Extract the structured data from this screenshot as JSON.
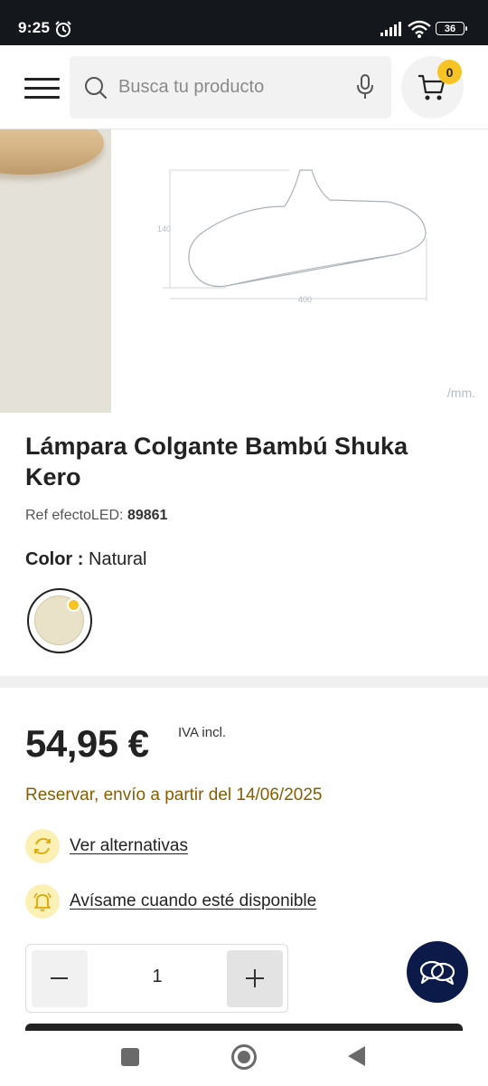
{
  "status_bar": {
    "time": "9:25",
    "battery": "36"
  },
  "header": {
    "search_placeholder": "Busca tu producto",
    "cart_count": "0"
  },
  "gallery": {
    "dimension_height": "140",
    "dimension_width": "400",
    "unit_label": "/mm."
  },
  "product": {
    "title": "Lámpara Colgante Bambú Shuka Kero",
    "ref_label": "Ref efectoLED:",
    "ref_value": "89861",
    "color_label": "Color :",
    "color_value": "Natural",
    "swatch_color": "#e9e2c8",
    "price": "54,95 €",
    "tax_note": "IVA incl.",
    "availability": "Reservar, envío a partir del 14/06/2025",
    "alternatives_link": "Ver alternativas",
    "notify_link": "Avísame cuando esté disponible",
    "quantity": "1"
  },
  "colors": {
    "accent": "#f7c325",
    "availability_text": "#8a5a00",
    "chat_button": "#0c1a4a"
  },
  "icons": {
    "alternatives": "refresh-icon",
    "notify": "bell-icon",
    "chat": "chat-bubbles-icon",
    "cart": "cart-icon",
    "search": "search-icon",
    "voice": "microphone-icon"
  }
}
